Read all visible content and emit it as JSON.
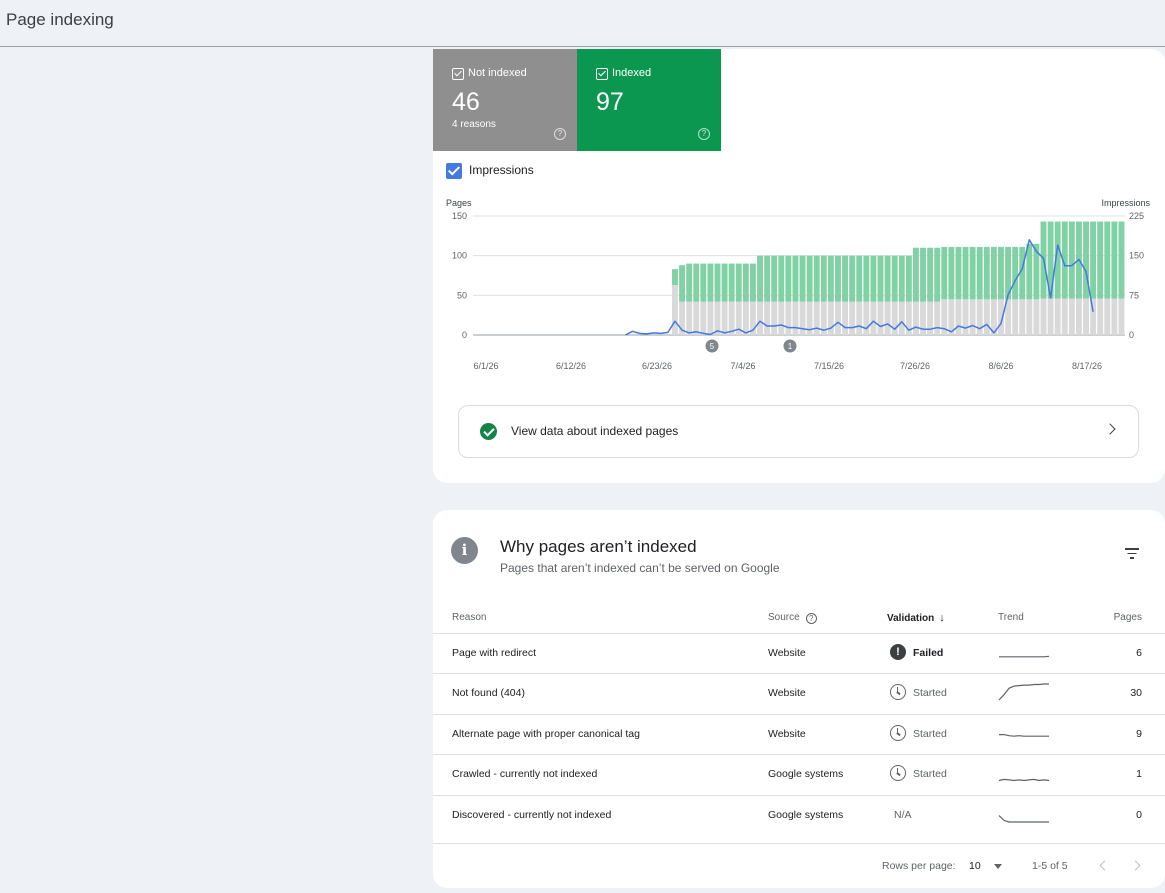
{
  "page": {
    "title": "Page indexing"
  },
  "tiles": {
    "not_indexed": {
      "label": "Not indexed",
      "value": "46",
      "sub": "4 reasons",
      "help": "?"
    },
    "indexed": {
      "label": "Indexed",
      "value": "97",
      "help": "?"
    }
  },
  "impressions_toggle": {
    "label": "Impressions",
    "checked": true
  },
  "chart_data": {
    "type": "bar",
    "left_axis_label": "Pages",
    "right_axis_label": "Impressions",
    "left_ticks": [
      "150",
      "100",
      "50",
      "0"
    ],
    "right_ticks": [
      "225",
      "150",
      "75",
      "0"
    ],
    "ylim_left": [
      0,
      150
    ],
    "ylim_right": [
      0,
      225
    ],
    "x_tick_labels": [
      "6/1/26",
      "6/12/26",
      "6/23/26",
      "7/4/26",
      "7/15/26",
      "7/26/26",
      "8/6/26",
      "8/17/26"
    ],
    "annotations": [
      "5",
      "1"
    ],
    "series": [
      {
        "name": "Not indexed",
        "color": "#d9d9d9",
        "values": [
          0,
          0,
          0,
          0,
          0,
          0,
          0,
          0,
          0,
          0,
          0,
          0,
          0,
          0,
          0,
          0,
          0,
          0,
          0,
          0,
          0,
          0,
          0,
          0,
          0,
          0,
          0,
          0,
          63,
          42,
          42,
          42,
          42,
          42,
          42,
          42,
          42,
          42,
          42,
          42,
          42,
          42,
          42,
          42,
          42,
          42,
          42,
          42,
          42,
          42,
          42,
          42,
          42,
          42,
          42,
          42,
          42,
          42,
          42,
          42,
          42,
          42,
          42,
          42,
          42,
          42,
          45,
          45,
          45,
          45,
          45,
          45,
          45,
          45,
          45,
          45,
          45,
          45,
          45,
          45,
          46,
          46,
          46,
          46,
          46,
          46,
          46,
          46,
          46,
          46,
          46,
          46
        ]
      },
      {
        "name": "Indexed",
        "color": "#80d1a3",
        "values": [
          0,
          0,
          0,
          0,
          0,
          0,
          0,
          0,
          0,
          0,
          0,
          0,
          0,
          0,
          0,
          0,
          0,
          0,
          0,
          0,
          0,
          0,
          0,
          0,
          0,
          0,
          0,
          0,
          20,
          46,
          48,
          48,
          48,
          48,
          48,
          48,
          48,
          48,
          48,
          48,
          58,
          58,
          58,
          58,
          58,
          58,
          58,
          58,
          58,
          58,
          58,
          58,
          58,
          58,
          58,
          58,
          58,
          58,
          58,
          58,
          58,
          58,
          68,
          68,
          68,
          68,
          66,
          66,
          66,
          66,
          66,
          66,
          66,
          66,
          66,
          66,
          66,
          66,
          70,
          70,
          97,
          97,
          97,
          97,
          97,
          97,
          97,
          97,
          97,
          97,
          97,
          97
        ]
      },
      {
        "name": "Impressions",
        "color": "#4479e0",
        "values": [
          0,
          0,
          0,
          0,
          0,
          0,
          0,
          0,
          0,
          0,
          0,
          0,
          0,
          0,
          0,
          0,
          0,
          0,
          0,
          0,
          0,
          0,
          7,
          3,
          2,
          4,
          3,
          5,
          26,
          9,
          4,
          6,
          3,
          1,
          8,
          4,
          7,
          11,
          4,
          9,
          26,
          17,
          17,
          19,
          14,
          14,
          12,
          10,
          13,
          9,
          13,
          24,
          14,
          14,
          17,
          12,
          26,
          16,
          21,
          11,
          25,
          9,
          15,
          11,
          11,
          14,
          12,
          6,
          17,
          13,
          18,
          12,
          20,
          4,
          22,
          76,
          103,
          125,
          180,
          158,
          145,
          70,
          170,
          131,
          131,
          143,
          120,
          44
        ]
      }
    ]
  },
  "view_indexed": {
    "label": "View data about indexed pages"
  },
  "why": {
    "title": "Why pages aren’t indexed",
    "subtitle": "Pages that aren’t indexed can’t be served on Google",
    "columns": {
      "reason": "Reason",
      "source": "Source",
      "validation": "Validation",
      "trend": "Trend",
      "pages": "Pages"
    },
    "rows": [
      {
        "reason": "Page with redirect",
        "source": "Website",
        "validation": "Failed",
        "status": "failed",
        "pages": "6",
        "trend": [
          6,
          6,
          6,
          6,
          6,
          6,
          6,
          6,
          6,
          6,
          7
        ]
      },
      {
        "reason": "Not found (404)",
        "source": "Website",
        "validation": "Started",
        "status": "started",
        "pages": "30",
        "trend": [
          0,
          10,
          22,
          26,
          27,
          28,
          28,
          29,
          29,
          30,
          30
        ]
      },
      {
        "reason": "Alternate page with proper canonical tag",
        "source": "Website",
        "validation": "Started",
        "status": "started",
        "pages": "9",
        "trend": [
          12,
          12,
          10,
          9,
          10,
          9,
          9,
          9,
          9,
          9,
          9
        ]
      },
      {
        "reason": "Crawled - currently not indexed",
        "source": "Google systems",
        "validation": "Started",
        "status": "started",
        "pages": "1",
        "trend": [
          1,
          3,
          2,
          1,
          2,
          1,
          2,
          3,
          1,
          2,
          1
        ]
      },
      {
        "reason": "Discovered - currently not indexed",
        "source": "Google systems",
        "validation": "N/A",
        "status": "na",
        "pages": "0",
        "trend": [
          12,
          3,
          0,
          0,
          0,
          0,
          0,
          0,
          0,
          0,
          0
        ]
      }
    ],
    "footer": {
      "rows_per_page_label": "Rows per page:",
      "rows_per_page": "10",
      "range": "1-5 of 5"
    }
  }
}
